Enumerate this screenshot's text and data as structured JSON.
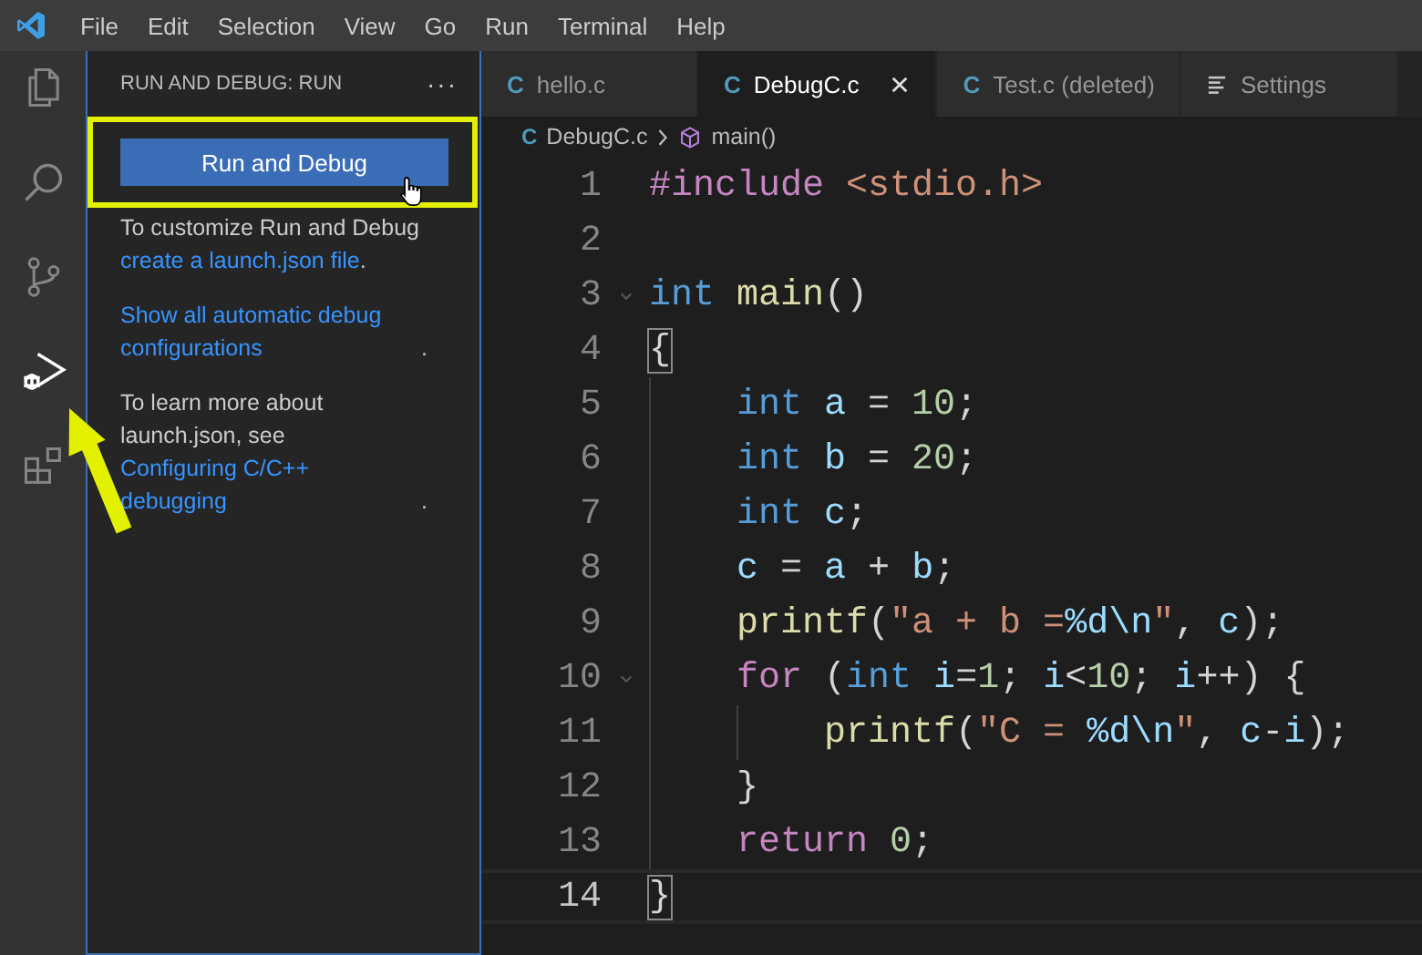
{
  "menu": [
    "File",
    "Edit",
    "Selection",
    "View",
    "Go",
    "Run",
    "Terminal",
    "Help"
  ],
  "activity_bar": [
    {
      "kind": "explorer",
      "selected": false
    },
    {
      "kind": "search",
      "selected": false
    },
    {
      "kind": "source-control",
      "selected": false
    },
    {
      "kind": "run-debug",
      "selected": true
    },
    {
      "kind": "extensions",
      "selected": false
    }
  ],
  "sidebar": {
    "title": "RUN AND DEBUG: RUN",
    "more": "···",
    "button": "Run and Debug",
    "paragraphs": [
      [
        {
          "kind": "text",
          "text": "To customize Run and Debug"
        },
        {
          "kind": "link",
          "text": "create a launch.json file"
        },
        {
          "kind": "text",
          "text": "."
        }
      ],
      [
        {
          "kind": "link",
          "text": "Show all automatic debug configurations"
        },
        {
          "kind": "text",
          "text": "."
        }
      ],
      [
        {
          "kind": "text",
          "text": "To learn more about launch.json, see"
        },
        {
          "kind": "link",
          "text": "Configuring C/C++ debugging"
        },
        {
          "kind": "text",
          "text": "."
        }
      ]
    ]
  },
  "tabs": [
    {
      "kind": "file",
      "icon_letter": "C",
      "label": "hello.c",
      "selected": false
    },
    {
      "kind": "file",
      "icon_letter": "C",
      "label": "DebugC.c",
      "selected": true
    },
    {
      "kind": "file",
      "icon_letter": "C",
      "label": "Test.c (deleted)",
      "selected": false
    },
    {
      "kind": "settings",
      "label": "Settings",
      "selected": false
    }
  ],
  "breadcrumbs": {
    "icon_letter": "C",
    "file": "DebugC.c",
    "symbol": "main()"
  },
  "code": [
    {
      "number": "1",
      "current": false,
      "tokens": [
        {
          "kind": "directive",
          "text": "#include"
        },
        {
          "kind": "header",
          "text": " <stdio.h>"
        }
      ]
    },
    {
      "number": "2",
      "current": false
    },
    {
      "number": "3",
      "current": false,
      "foldable": true,
      "tokens": [
        {
          "kind": "type",
          "text": "int"
        },
        {
          "kind": "func",
          "text": " main"
        },
        {
          "kind": "plain",
          "text": "()"
        }
      ]
    },
    {
      "number": "4",
      "current": false,
      "tokens": [
        {
          "kind": "match",
          "text": "{"
        }
      ]
    },
    {
      "number": "5",
      "current": false,
      "tokens": [
        {
          "kind": "type",
          "text": "    int"
        },
        {
          "kind": "var",
          "text": " a"
        },
        {
          "kind": "plain",
          "text": " = "
        },
        {
          "kind": "num",
          "text": "10"
        },
        {
          "kind": "plain",
          "text": ";"
        }
      ]
    },
    {
      "number": "6",
      "current": false,
      "tokens": [
        {
          "kind": "type",
          "text": "    int"
        },
        {
          "kind": "var",
          "text": " b"
        },
        {
          "kind": "plain",
          "text": " = "
        },
        {
          "kind": "num",
          "text": "20"
        },
        {
          "kind": "plain",
          "text": ";"
        }
      ]
    },
    {
      "number": "7",
      "current": false,
      "tokens": [
        {
          "kind": "type",
          "text": "    int"
        },
        {
          "kind": "var",
          "text": " c"
        },
        {
          "kind": "plain",
          "text": ";"
        }
      ]
    },
    {
      "number": "8",
      "current": false,
      "tokens": [
        {
          "kind": "var",
          "text": "    c"
        },
        {
          "kind": "plain",
          "text": " = "
        },
        {
          "kind": "var",
          "text": "a"
        },
        {
          "kind": "plain",
          "text": " + "
        },
        {
          "kind": "var",
          "text": "b"
        },
        {
          "kind": "plain",
          "text": ";"
        }
      ]
    },
    {
      "number": "9",
      "current": false,
      "tokens": [
        {
          "kind": "func",
          "text": "    printf"
        },
        {
          "kind": "plain",
          "text": "("
        },
        {
          "kind": "str",
          "text": "\"a + b ="
        },
        {
          "kind": "fmt",
          "text": "%d\\n"
        },
        {
          "kind": "str",
          "text": "\""
        },
        {
          "kind": "plain",
          "text": ", "
        },
        {
          "kind": "var",
          "text": "c"
        },
        {
          "kind": "plain",
          "text": ");"
        }
      ]
    },
    {
      "number": "10",
      "current": false,
      "foldable": true,
      "tokens": [
        {
          "kind": "ctrl",
          "text": "    for"
        },
        {
          "kind": "plain",
          "text": " ("
        },
        {
          "kind": "type",
          "text": "int"
        },
        {
          "kind": "var",
          "text": " i"
        },
        {
          "kind": "plain",
          "text": "="
        },
        {
          "kind": "num",
          "text": "1"
        },
        {
          "kind": "plain",
          "text": "; "
        },
        {
          "kind": "var",
          "text": "i"
        },
        {
          "kind": "plain",
          "text": "<"
        },
        {
          "kind": "num",
          "text": "10"
        },
        {
          "kind": "plain",
          "text": "; "
        },
        {
          "kind": "var",
          "text": "i"
        },
        {
          "kind": "plain",
          "text": "++) {"
        }
      ]
    },
    {
      "number": "11",
      "current": false,
      "tokens": [
        {
          "kind": "func",
          "text": "        printf"
        },
        {
          "kind": "plain",
          "text": "("
        },
        {
          "kind": "str",
          "text": "\"C = "
        },
        {
          "kind": "fmt",
          "text": "%d\\n"
        },
        {
          "kind": "str",
          "text": "\""
        },
        {
          "kind": "plain",
          "text": ", "
        },
        {
          "kind": "var",
          "text": "c"
        },
        {
          "kind": "plain",
          "text": "-"
        },
        {
          "kind": "var",
          "text": "i"
        },
        {
          "kind": "plain",
          "text": ");"
        }
      ]
    },
    {
      "number": "12",
      "current": false,
      "tokens": [
        {
          "kind": "plain",
          "text": "    }"
        }
      ]
    },
    {
      "number": "13",
      "current": false,
      "tokens": [
        {
          "kind": "ctrl",
          "text": "    return"
        },
        {
          "kind": "num",
          "text": " 0"
        },
        {
          "kind": "plain",
          "text": ";"
        }
      ]
    },
    {
      "number": "14",
      "current": true,
      "tokens": [
        {
          "kind": "match",
          "text": "}"
        }
      ]
    }
  ]
}
